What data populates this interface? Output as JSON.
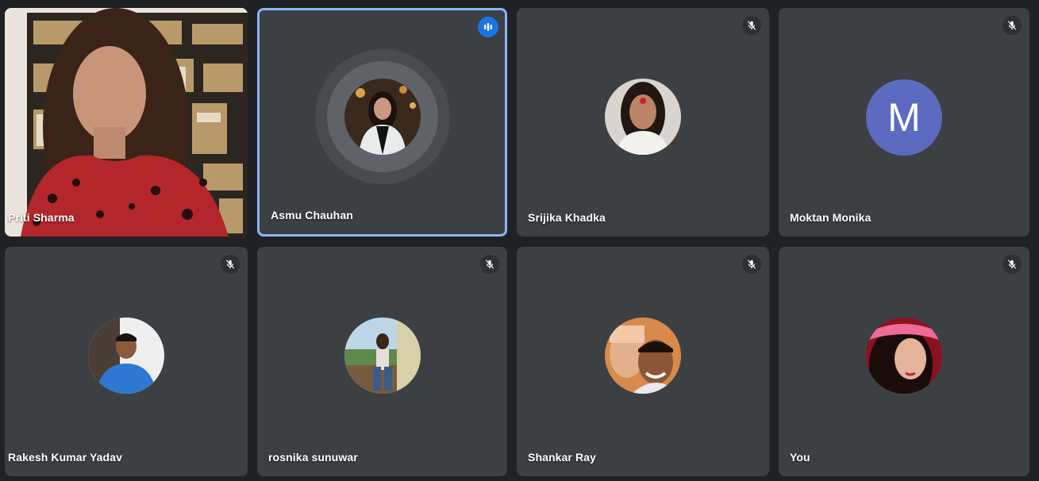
{
  "participants": [
    {
      "name": "Priti Sharma",
      "type": "video",
      "muted": false
    },
    {
      "name": "Asmu Chauhan",
      "type": "avatar",
      "speaking": true
    },
    {
      "name": "Srijika Khadka",
      "type": "avatar",
      "muted": true
    },
    {
      "name": "Moktan Monika",
      "type": "letter",
      "initial": "M",
      "muted": true
    },
    {
      "name": "Rakesh Kumar Yadav",
      "type": "avatar",
      "muted": true
    },
    {
      "name": "rosnika sunuwar",
      "type": "avatar",
      "muted": true
    },
    {
      "name": "Shankar Ray",
      "type": "avatar",
      "muted": true
    },
    {
      "name": "You",
      "type": "avatar",
      "muted": true
    }
  ],
  "icons": {
    "mic_off": "mic-off-icon",
    "speaking": "audio-level-icon"
  },
  "colors": {
    "tile_bg": "#3c4043",
    "page_bg": "#202124",
    "speaking_border": "#8ab4f8",
    "speaking_badge": "#1a73e8",
    "letter_avatar_bg": "#5c6bc0"
  }
}
